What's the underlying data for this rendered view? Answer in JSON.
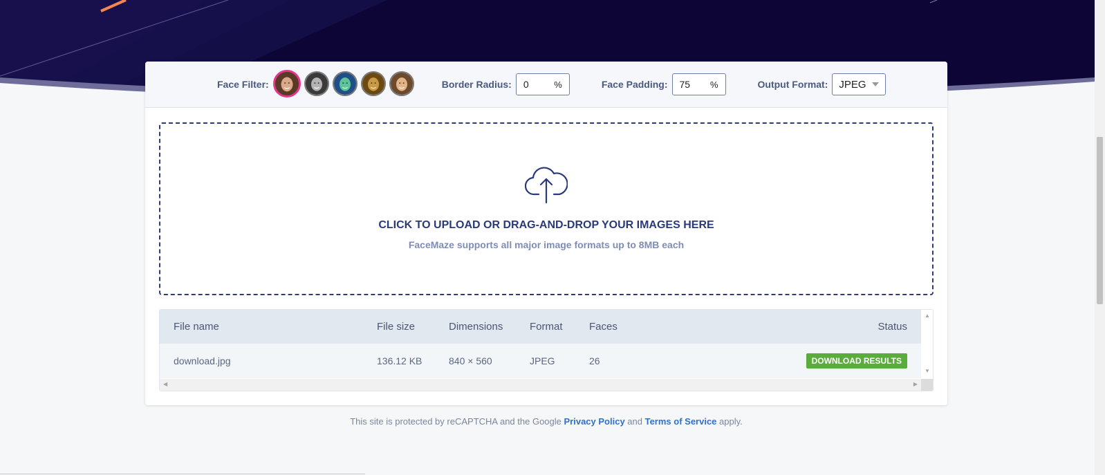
{
  "toolbar": {
    "face_filter_label": "Face Filter:",
    "filters": [
      {
        "name": "original",
        "active": true
      },
      {
        "name": "grayscale",
        "active": false
      },
      {
        "name": "teal",
        "active": false
      },
      {
        "name": "sepia-gold",
        "active": false
      },
      {
        "name": "warm",
        "active": false
      }
    ],
    "border_radius_label": "Border Radius:",
    "border_radius_value": "0",
    "border_radius_unit": "%",
    "face_padding_label": "Face Padding:",
    "face_padding_value": "75",
    "face_padding_unit": "%",
    "output_format_label": "Output Format:",
    "output_format_value": "JPEG"
  },
  "dropzone": {
    "icon": "cloud-upload-icon",
    "title": "CLICK TO UPLOAD OR DRAG-AND-DROP YOUR IMAGES HERE",
    "subtitle": "FaceMaze supports all major image formats up to 8MB each"
  },
  "table": {
    "columns": [
      "File name",
      "File size",
      "Dimensions",
      "Format",
      "Faces",
      "Status"
    ],
    "rows": [
      {
        "file_name": "download.jpg",
        "file_size": "136.12 KB",
        "dimensions": "840 × 560",
        "format": "JPEG",
        "faces": "26",
        "action": "DOWNLOAD RESULTS"
      }
    ]
  },
  "footer": {
    "text_before": "This site is protected by reCAPTCHA and the Google ",
    "privacy_link": "Privacy Policy",
    "text_middle": " and ",
    "terms_link": "Terms of Service",
    "text_after": " apply."
  },
  "colors": {
    "hero": "#0c0536",
    "accent_pink": "#e5368e",
    "accent_orange": "#f4874e",
    "navy": "#2a3a78",
    "success": "#5aac3d",
    "link": "#2e6fd1"
  }
}
